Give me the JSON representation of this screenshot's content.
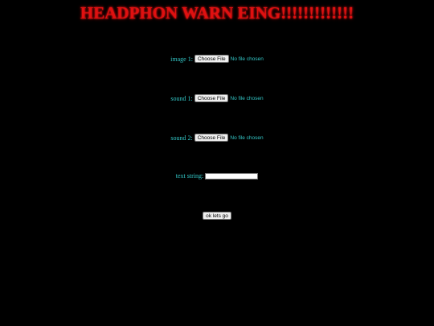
{
  "title": "HEADPHON WARN EING!!!!!!!!!!!!!",
  "fields": {
    "image1": {
      "label": "image 1:",
      "button_label": "Choose File",
      "status": "No file chosen"
    },
    "sound1": {
      "label": "sound 1:",
      "button_label": "Choose File",
      "status": "No file chosen"
    },
    "sound2": {
      "label": "sound 2:",
      "button_label": "Choose File",
      "status": "No file chosen"
    },
    "text_string": {
      "label": "text string:",
      "value": ""
    }
  },
  "submit": {
    "label": "ok lets go"
  },
  "colors": {
    "background": "#000000",
    "title": "#e01010",
    "label": "#33c7c7"
  }
}
